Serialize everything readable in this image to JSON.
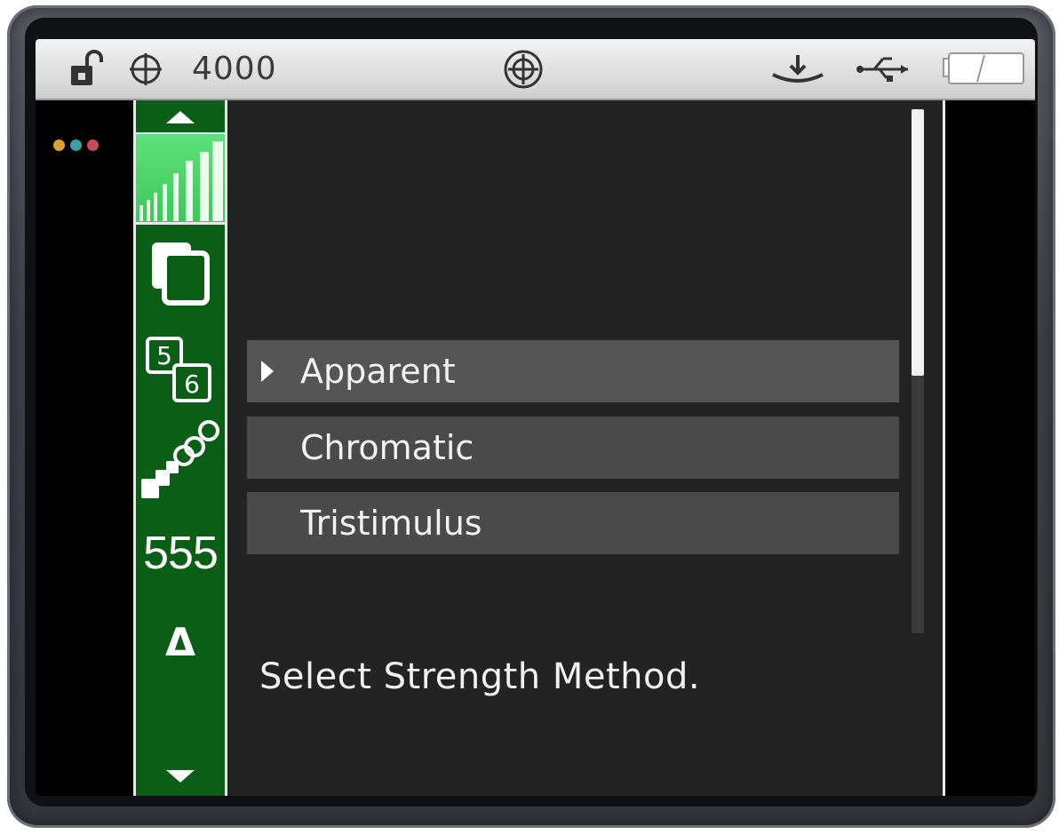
{
  "statusbar": {
    "lock_icon": "lock-open-icon",
    "crosshair_icon": "crosshair-icon",
    "value": "4000",
    "target_icon": "target-icon",
    "download_icon": "download-tray-icon",
    "usb_icon": "usb-icon",
    "battery_icon": "battery-icon"
  },
  "indicator_dots": [
    "#e0a030",
    "#3aa0a8",
    "#c84a58"
  ],
  "sidebar": {
    "up_icon": "arrow-up-icon",
    "level_icon": "signal-bars-icon",
    "copy_icon": "copy-pages-icon",
    "sample_icon": "sample-5-6-icon",
    "scatter_icon": "scatter-dots-icon",
    "count": "555",
    "delta": "Δ",
    "down_icon": "arrow-down-icon"
  },
  "menu": {
    "options": [
      {
        "label": "Apparent",
        "selected": true
      },
      {
        "label": "Chromatic",
        "selected": false
      },
      {
        "label": "Tristimulus",
        "selected": false
      }
    ],
    "hint": "Select Strength Method."
  },
  "colors": {
    "sidebar_green": "#0b5e16",
    "level_green": "#4ed468",
    "panel": "#232323",
    "option_bg": "#4a4a4a"
  }
}
